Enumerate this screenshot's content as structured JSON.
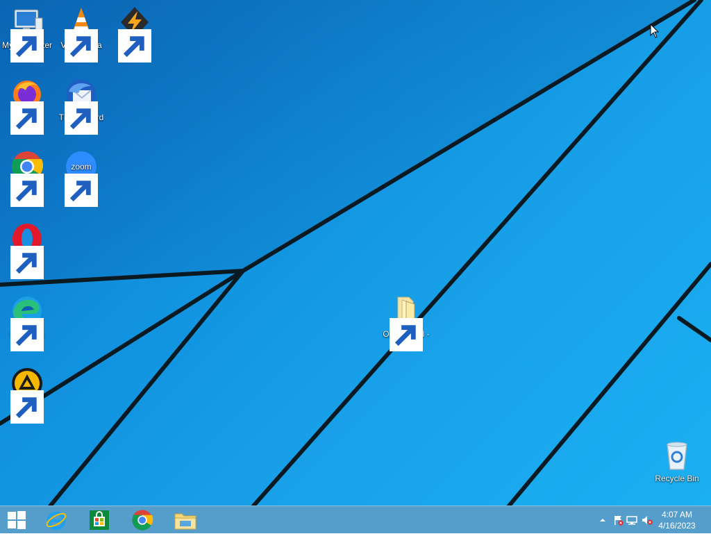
{
  "desktop": {
    "icons": [
      {
        "label": "My Computer"
      },
      {
        "label": "VLC media player"
      },
      {
        "label": "Winamp"
      },
      {
        "label": "Firefox"
      },
      {
        "label": "Thunderbird"
      },
      {
        "label": "Google Chrome"
      },
      {
        "label": "Zoom"
      },
      {
        "label": "Opera Browser"
      },
      {
        "label": "Microsoft Edge"
      },
      {
        "label": "AIMP"
      },
      {
        "label": "Open-Shell - Shortcut"
      },
      {
        "label": "Recycle Bin"
      }
    ]
  },
  "taskbar": {
    "pinned": [
      {
        "name": "start-button"
      },
      {
        "name": "internet-explorer"
      },
      {
        "name": "store"
      },
      {
        "name": "google-chrome"
      },
      {
        "name": "file-explorer"
      }
    ],
    "tray": {
      "icons": [
        "chevron-up-icon",
        "action-center-flag-icon",
        "network-icon",
        "volume-muted-icon"
      ],
      "time": "4:07 AM",
      "date": "4/16/2023"
    }
  },
  "colors": {
    "wallpaper_blue": "#1191de",
    "taskbar": "#4696c8"
  }
}
